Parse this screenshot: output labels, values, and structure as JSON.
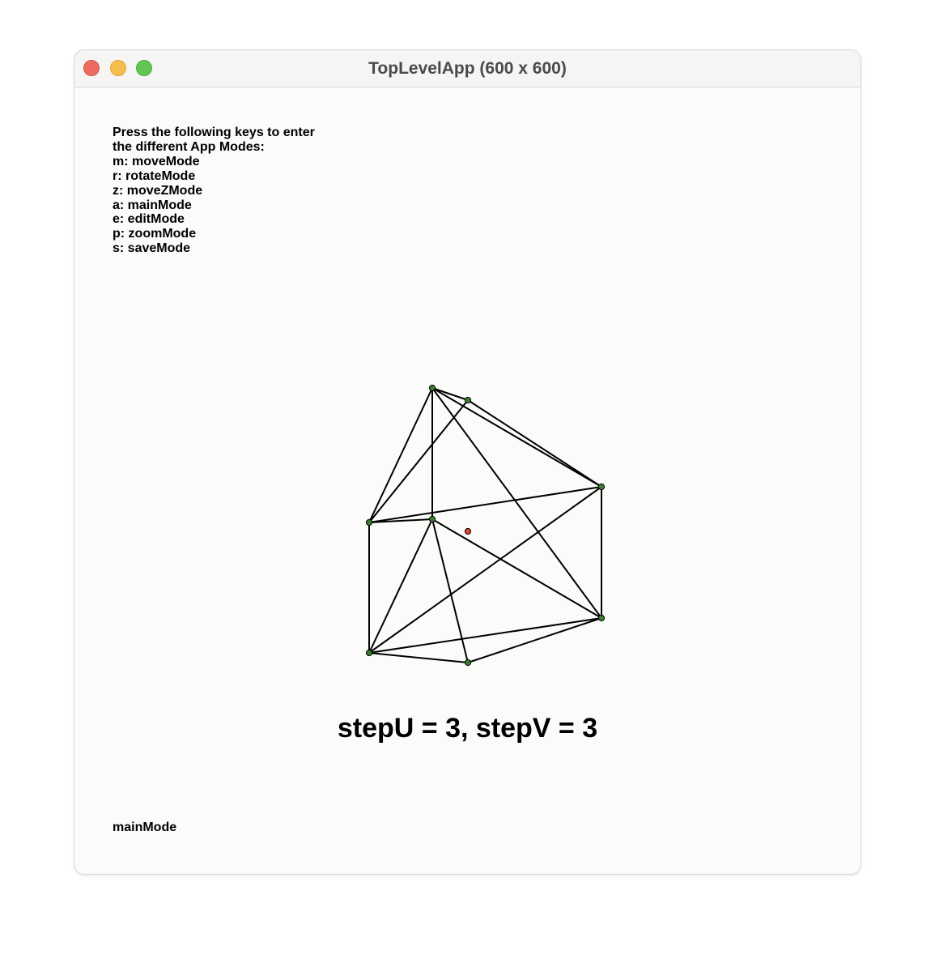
{
  "window": {
    "title": "TopLevelApp (600 x 600)"
  },
  "instructions": [
    "Press the following keys to enter",
    "the different App Modes:",
    "m: moveMode",
    "r: rotateMode",
    "z: moveZMode",
    "a: mainMode",
    "e: editMode",
    "p: zoomMode",
    "s: saveMode"
  ],
  "step_label": "stepU = 3, stepV = 3",
  "mode_label": "mainMode",
  "colors": {
    "vertex": "#3a7d2c",
    "center": "#d9442b",
    "edge": "#000000"
  }
}
